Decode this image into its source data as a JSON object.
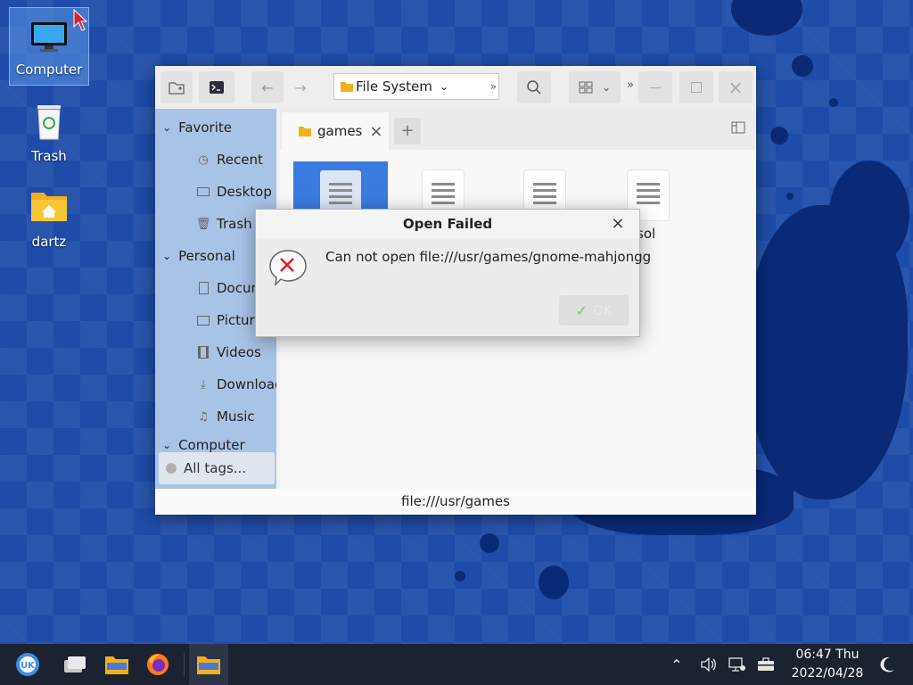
{
  "desktop": {
    "icons": [
      {
        "label": "Computer"
      },
      {
        "label": "Trash"
      },
      {
        "label": "dartz"
      }
    ]
  },
  "file_manager": {
    "address": "File System",
    "address_overflow": "»",
    "toolbar_overflow": "»",
    "sidebar": {
      "favorite_label": "Favorite",
      "favorite_items": [
        "Recent",
        "Desktop",
        "Trash"
      ],
      "personal_label": "Personal",
      "personal_items": [
        "Documents",
        "Pictures",
        "Videos",
        "Downloads",
        "Music"
      ],
      "computer_label": "Computer",
      "all_tags": "All tags..."
    },
    "tab_label": "games",
    "add_tab": "+",
    "files": [
      {
        "name": ""
      },
      {
        "name": ""
      },
      {
        "name": ""
      },
      {
        "name": "sol"
      }
    ],
    "status": "file:///usr/games"
  },
  "dialog": {
    "title": "Open Failed",
    "message": "Can not open file:///usr/games/gnome-mahjongg",
    "ok_label": "OK"
  },
  "taskbar": {
    "time": "06:47 Thu",
    "date": "2022/04/28"
  },
  "colors": {
    "desktop_bg": "#1e4ca8",
    "sidebar_bg": "#a9c3e6",
    "selection": "#3b7be0",
    "taskbar_bg": "#1b2230",
    "error_red": "#e02020"
  }
}
